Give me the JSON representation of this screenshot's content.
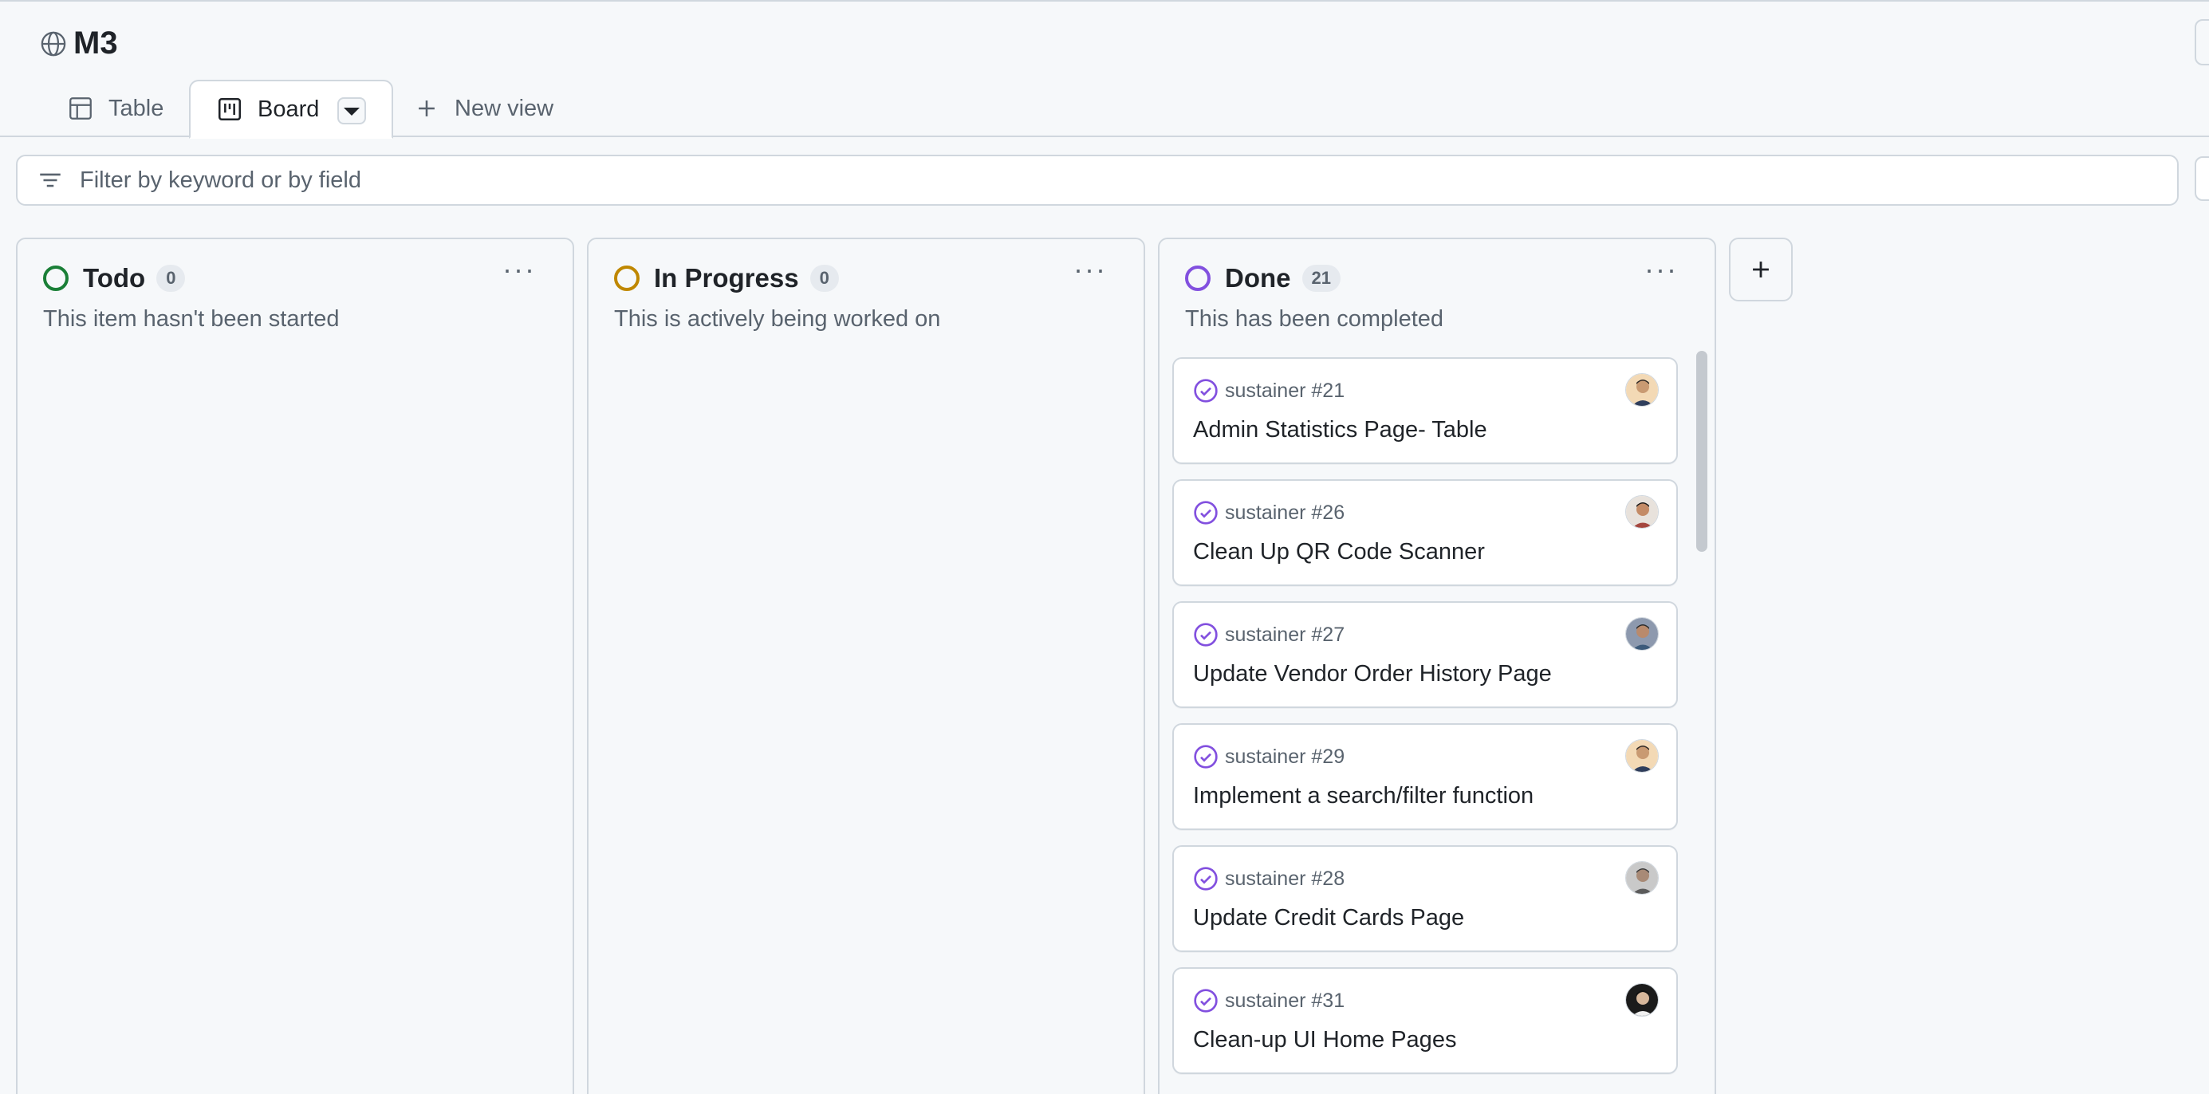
{
  "project": {
    "title": "M3"
  },
  "tabs": [
    {
      "label": "Table"
    },
    {
      "label": "Board"
    },
    {
      "label": "New view"
    }
  ],
  "filter": {
    "placeholder": "Filter by keyword or by field"
  },
  "columns": [
    {
      "name": "Todo",
      "count": "0",
      "description": "This item hasn't been started",
      "color": "#1a7f37"
    },
    {
      "name": "In Progress",
      "count": "0",
      "description": "This is actively being worked on",
      "color": "#9a6700"
    },
    {
      "name": "Done",
      "count": "21",
      "description": "This has been completed",
      "color": "#8250df",
      "cards": [
        {
          "meta": "sustainer #21",
          "title": "Admin Statistics Page- Table"
        },
        {
          "meta": "sustainer #26",
          "title": "Clean Up QR Code Scanner"
        },
        {
          "meta": "sustainer #27",
          "title": "Update Vendor Order History Page"
        },
        {
          "meta": "sustainer #29",
          "title": "Implement a search/filter function"
        },
        {
          "meta": "sustainer #28",
          "title": "Update Credit Cards Page"
        },
        {
          "meta": "sustainer #31",
          "title": "Clean-up UI Home Pages"
        }
      ]
    }
  ],
  "colors": {
    "accent_done": "#8250df",
    "border": "#d0d7de",
    "muted": "#59636e"
  }
}
